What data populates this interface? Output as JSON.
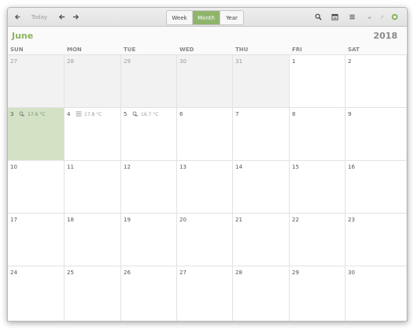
{
  "toolbar": {
    "today_label": "Today",
    "views": [
      {
        "label": "Week",
        "active": false
      },
      {
        "label": "Month",
        "active": true
      },
      {
        "label": "Year",
        "active": false
      }
    ],
    "icons": [
      "back-icon",
      "previous-arrow-icon",
      "next-arrow-icon",
      "search-icon",
      "calendar-management-icon",
      "menu-icon",
      "minimize-icon",
      "maximize-icon",
      "close-icon"
    ]
  },
  "header": {
    "month": "June",
    "year": "2018"
  },
  "weekdays": [
    "SUN",
    "MON",
    "TUE",
    "WED",
    "THU",
    "FRI",
    "SAT"
  ],
  "weeks": [
    [
      {
        "day": "27",
        "other": true
      },
      {
        "day": "28",
        "other": true
      },
      {
        "day": "29",
        "other": true
      },
      {
        "day": "30",
        "other": true
      },
      {
        "day": "31",
        "other": true
      },
      {
        "day": "1"
      },
      {
        "day": "2"
      }
    ],
    [
      {
        "day": "3",
        "today": true,
        "weather": "17.6 °C",
        "weather_icon": "cloudy-icon"
      },
      {
        "day": "4",
        "weather": "17.8 °C",
        "weather_icon": "fog-icon"
      },
      {
        "day": "5",
        "weather": "16.7 °C",
        "weather_icon": "cloudy-icon"
      },
      {
        "day": "6"
      },
      {
        "day": "7"
      },
      {
        "day": "8"
      },
      {
        "day": "9"
      }
    ],
    [
      {
        "day": "10"
      },
      {
        "day": "11"
      },
      {
        "day": "12"
      },
      {
        "day": "13"
      },
      {
        "day": "14"
      },
      {
        "day": "15"
      },
      {
        "day": "16"
      }
    ],
    [
      {
        "day": "17"
      },
      {
        "day": "18"
      },
      {
        "day": "19"
      },
      {
        "day": "20"
      },
      {
        "day": "21"
      },
      {
        "day": "22"
      },
      {
        "day": "23"
      }
    ],
    [
      {
        "day": "24"
      },
      {
        "day": "25"
      },
      {
        "day": "26"
      },
      {
        "day": "27"
      },
      {
        "day": "28"
      },
      {
        "day": "29"
      },
      {
        "day": "30"
      }
    ]
  ],
  "colors": {
    "accent": "#8fb56b",
    "today_bg": "#d3e2c4",
    "month_title": "#8cb55f",
    "other_month_bg": "#f2f2f2"
  }
}
